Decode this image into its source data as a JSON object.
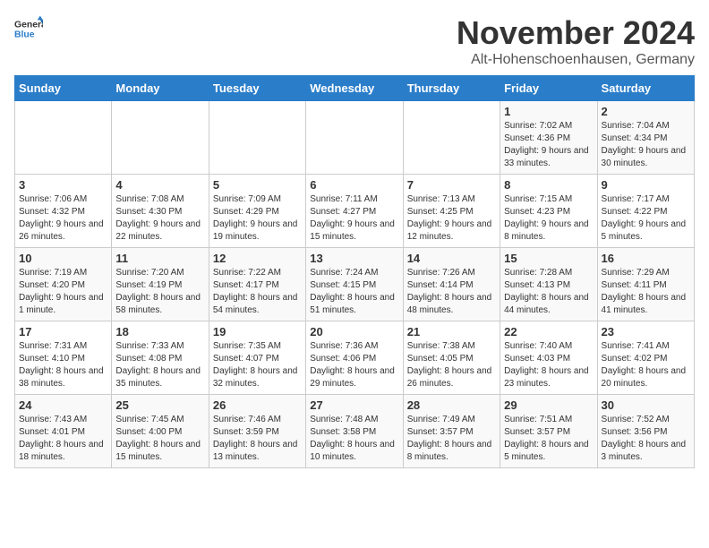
{
  "header": {
    "logo_general": "General",
    "logo_blue": "Blue",
    "title": "November 2024",
    "subtitle": "Alt-Hohenschoenhausen, Germany"
  },
  "days_of_week": [
    "Sunday",
    "Monday",
    "Tuesday",
    "Wednesday",
    "Thursday",
    "Friday",
    "Saturday"
  ],
  "weeks": [
    [
      {
        "day": "",
        "info": ""
      },
      {
        "day": "",
        "info": ""
      },
      {
        "day": "",
        "info": ""
      },
      {
        "day": "",
        "info": ""
      },
      {
        "day": "",
        "info": ""
      },
      {
        "day": "1",
        "info": "Sunrise: 7:02 AM\nSunset: 4:36 PM\nDaylight: 9 hours and 33 minutes."
      },
      {
        "day": "2",
        "info": "Sunrise: 7:04 AM\nSunset: 4:34 PM\nDaylight: 9 hours and 30 minutes."
      }
    ],
    [
      {
        "day": "3",
        "info": "Sunrise: 7:06 AM\nSunset: 4:32 PM\nDaylight: 9 hours and 26 minutes."
      },
      {
        "day": "4",
        "info": "Sunrise: 7:08 AM\nSunset: 4:30 PM\nDaylight: 9 hours and 22 minutes."
      },
      {
        "day": "5",
        "info": "Sunrise: 7:09 AM\nSunset: 4:29 PM\nDaylight: 9 hours and 19 minutes."
      },
      {
        "day": "6",
        "info": "Sunrise: 7:11 AM\nSunset: 4:27 PM\nDaylight: 9 hours and 15 minutes."
      },
      {
        "day": "7",
        "info": "Sunrise: 7:13 AM\nSunset: 4:25 PM\nDaylight: 9 hours and 12 minutes."
      },
      {
        "day": "8",
        "info": "Sunrise: 7:15 AM\nSunset: 4:23 PM\nDaylight: 9 hours and 8 minutes."
      },
      {
        "day": "9",
        "info": "Sunrise: 7:17 AM\nSunset: 4:22 PM\nDaylight: 9 hours and 5 minutes."
      }
    ],
    [
      {
        "day": "10",
        "info": "Sunrise: 7:19 AM\nSunset: 4:20 PM\nDaylight: 9 hours and 1 minute."
      },
      {
        "day": "11",
        "info": "Sunrise: 7:20 AM\nSunset: 4:19 PM\nDaylight: 8 hours and 58 minutes."
      },
      {
        "day": "12",
        "info": "Sunrise: 7:22 AM\nSunset: 4:17 PM\nDaylight: 8 hours and 54 minutes."
      },
      {
        "day": "13",
        "info": "Sunrise: 7:24 AM\nSunset: 4:15 PM\nDaylight: 8 hours and 51 minutes."
      },
      {
        "day": "14",
        "info": "Sunrise: 7:26 AM\nSunset: 4:14 PM\nDaylight: 8 hours and 48 minutes."
      },
      {
        "day": "15",
        "info": "Sunrise: 7:28 AM\nSunset: 4:13 PM\nDaylight: 8 hours and 44 minutes."
      },
      {
        "day": "16",
        "info": "Sunrise: 7:29 AM\nSunset: 4:11 PM\nDaylight: 8 hours and 41 minutes."
      }
    ],
    [
      {
        "day": "17",
        "info": "Sunrise: 7:31 AM\nSunset: 4:10 PM\nDaylight: 8 hours and 38 minutes."
      },
      {
        "day": "18",
        "info": "Sunrise: 7:33 AM\nSunset: 4:08 PM\nDaylight: 8 hours and 35 minutes."
      },
      {
        "day": "19",
        "info": "Sunrise: 7:35 AM\nSunset: 4:07 PM\nDaylight: 8 hours and 32 minutes."
      },
      {
        "day": "20",
        "info": "Sunrise: 7:36 AM\nSunset: 4:06 PM\nDaylight: 8 hours and 29 minutes."
      },
      {
        "day": "21",
        "info": "Sunrise: 7:38 AM\nSunset: 4:05 PM\nDaylight: 8 hours and 26 minutes."
      },
      {
        "day": "22",
        "info": "Sunrise: 7:40 AM\nSunset: 4:03 PM\nDaylight: 8 hours and 23 minutes."
      },
      {
        "day": "23",
        "info": "Sunrise: 7:41 AM\nSunset: 4:02 PM\nDaylight: 8 hours and 20 minutes."
      }
    ],
    [
      {
        "day": "24",
        "info": "Sunrise: 7:43 AM\nSunset: 4:01 PM\nDaylight: 8 hours and 18 minutes."
      },
      {
        "day": "25",
        "info": "Sunrise: 7:45 AM\nSunset: 4:00 PM\nDaylight: 8 hours and 15 minutes."
      },
      {
        "day": "26",
        "info": "Sunrise: 7:46 AM\nSunset: 3:59 PM\nDaylight: 8 hours and 13 minutes."
      },
      {
        "day": "27",
        "info": "Sunrise: 7:48 AM\nSunset: 3:58 PM\nDaylight: 8 hours and 10 minutes."
      },
      {
        "day": "28",
        "info": "Sunrise: 7:49 AM\nSunset: 3:57 PM\nDaylight: 8 hours and 8 minutes."
      },
      {
        "day": "29",
        "info": "Sunrise: 7:51 AM\nSunset: 3:57 PM\nDaylight: 8 hours and 5 minutes."
      },
      {
        "day": "30",
        "info": "Sunrise: 7:52 AM\nSunset: 3:56 PM\nDaylight: 8 hours and 3 minutes."
      }
    ]
  ]
}
